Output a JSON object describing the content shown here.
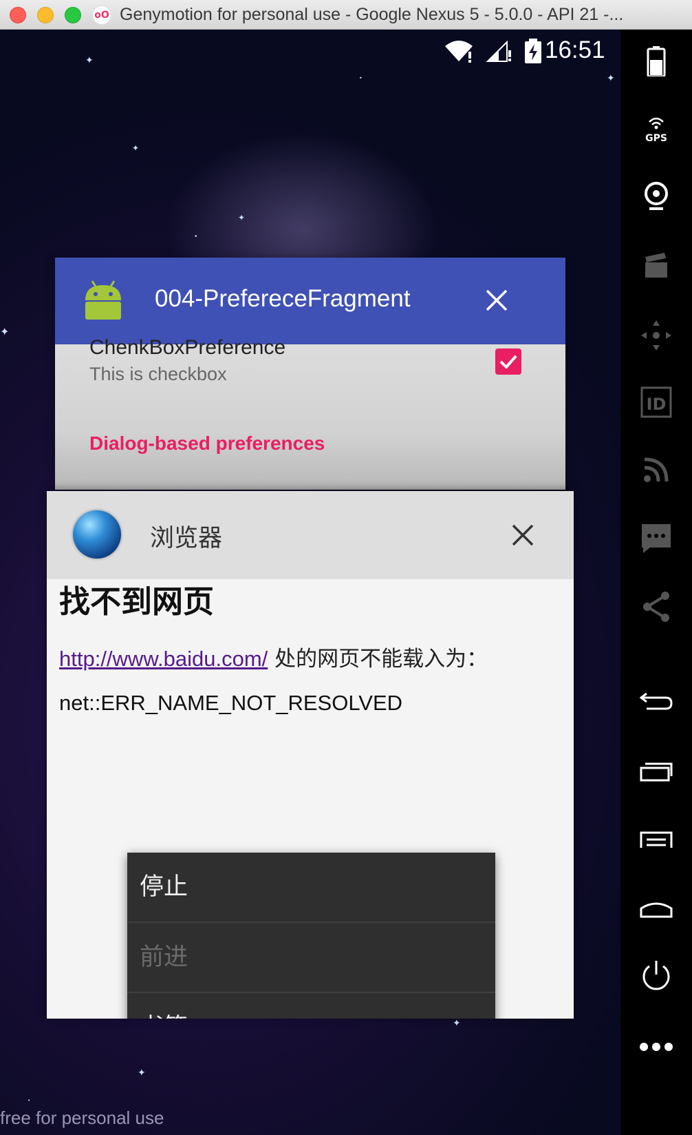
{
  "window": {
    "title": "Genymotion for personal use - Google Nexus 5 - 5.0.0 - API 21 -...",
    "app_icon_text": "oO"
  },
  "statusbar": {
    "time": "16:51"
  },
  "watermark": "free for personal use",
  "recents": {
    "card1": {
      "app_title": "004-PreferecеFragment",
      "pref_title": "ChenkBoxPreference",
      "pref_summary": "This is checkbox",
      "checkbox_checked": true,
      "category": "Dialog-based preferences",
      "header_color": "#3f51b5",
      "accent_color": "#e91e63"
    },
    "card2": {
      "app_title": "浏览器",
      "page_heading": "找不到网页",
      "error_link": "http://www.baidu.com/",
      "error_text": " 处的网页不能载入为：",
      "error_code": "net::ERR_NAME_NOT_RESOLVED",
      "menu": [
        {
          "label": "停止",
          "enabled": true
        },
        {
          "label": "前进",
          "enabled": false
        },
        {
          "label": "书签",
          "enabled": true
        }
      ]
    }
  },
  "sidebar": {
    "gps_label": "GPS",
    "id_label": "ID",
    "items": [
      "battery-icon",
      "gps-icon",
      "webcam-icon",
      "capture-icon",
      "dpad-icon",
      "id-icon",
      "cast-icon",
      "sms-icon",
      "share-icon",
      "back-icon",
      "recents-icon",
      "menu-icon",
      "home-icon",
      "power-icon",
      "more-icon"
    ]
  }
}
